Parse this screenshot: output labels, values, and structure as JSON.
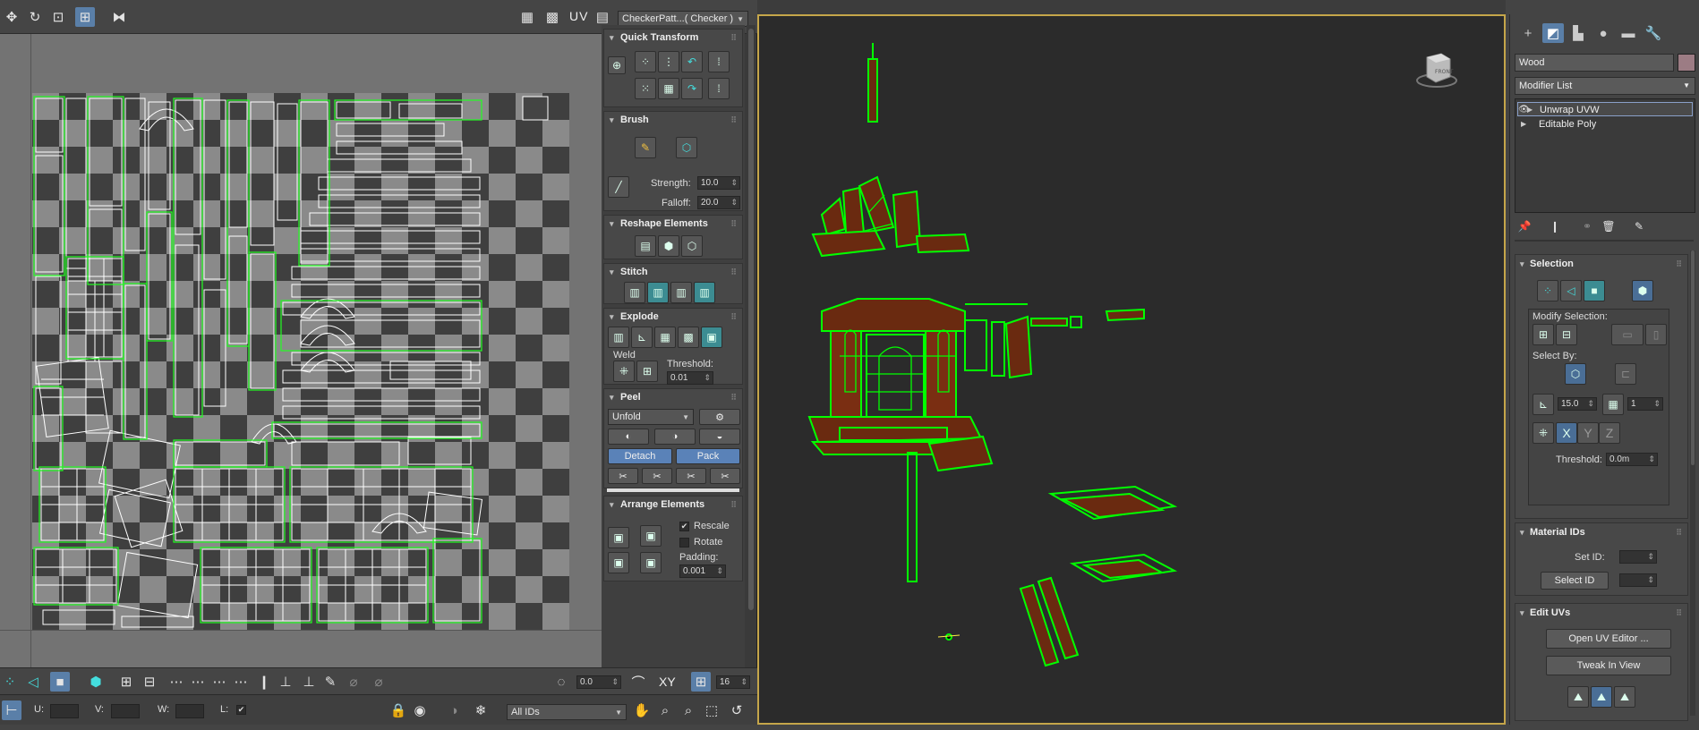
{
  "uv_editor": {
    "toolbar": {
      "uv_label": "UV",
      "texture_dropdown": "CheckerPatt...( Checker )"
    },
    "rollouts": {
      "quick_transform": {
        "title": "Quick Transform"
      },
      "brush": {
        "title": "Brush",
        "strength_label": "Strength:",
        "strength_value": "10.0",
        "falloff_label": "Falloff:",
        "falloff_value": "20.0"
      },
      "reshape": {
        "title": "Reshape Elements"
      },
      "stitch": {
        "title": "Stitch"
      },
      "explode": {
        "title": "Explode",
        "weld_label": "Weld",
        "threshold_label": "Threshold:",
        "threshold_value": "0.01"
      },
      "peel": {
        "title": "Peel",
        "mode_dropdown": "Unfold",
        "detach_label": "Detach",
        "pack_label": "Pack"
      },
      "arrange": {
        "title": "Arrange Elements",
        "rescale_label": "Rescale",
        "rescale_checked": true,
        "rotate_label": "Rotate",
        "rotate_checked": false,
        "padding_label": "Padding:",
        "padding_value": "0.001"
      }
    },
    "bottom_bar": {
      "rotate_value": "0.0",
      "xy_label": "XY",
      "grid_value": "16",
      "u_label": "U:",
      "v_label": "V:",
      "w_label": "W:",
      "l_label": "L:",
      "ids_dropdown": "All IDs"
    }
  },
  "command_panel": {
    "object_name": "Wood",
    "object_color": "#9c7c84",
    "modifier_list_label": "Modifier List",
    "stack": [
      {
        "label": "Unwrap UVW",
        "selected": true
      },
      {
        "label": "Editable Poly",
        "selected": false
      }
    ],
    "selection": {
      "title": "Selection",
      "modify_selection_label": "Modify Selection:",
      "select_by_label": "Select By:",
      "angle_value": "15.0",
      "count_value": "1",
      "axes": [
        "X",
        "Y",
        "Z"
      ],
      "threshold_label": "Threshold:",
      "threshold_value": "0.0m"
    },
    "material_ids": {
      "title": "Material IDs",
      "set_id_label": "Set ID:",
      "select_id_label": "Select ID"
    },
    "edit_uvs": {
      "title": "Edit UVs",
      "open_editor_label": "Open UV Editor ...",
      "tweak_label": "Tweak In View"
    }
  },
  "viewport": {
    "viewcube_label": "FRONT",
    "wire_color": "#00ff00",
    "wood_color": "#7a2e12"
  }
}
